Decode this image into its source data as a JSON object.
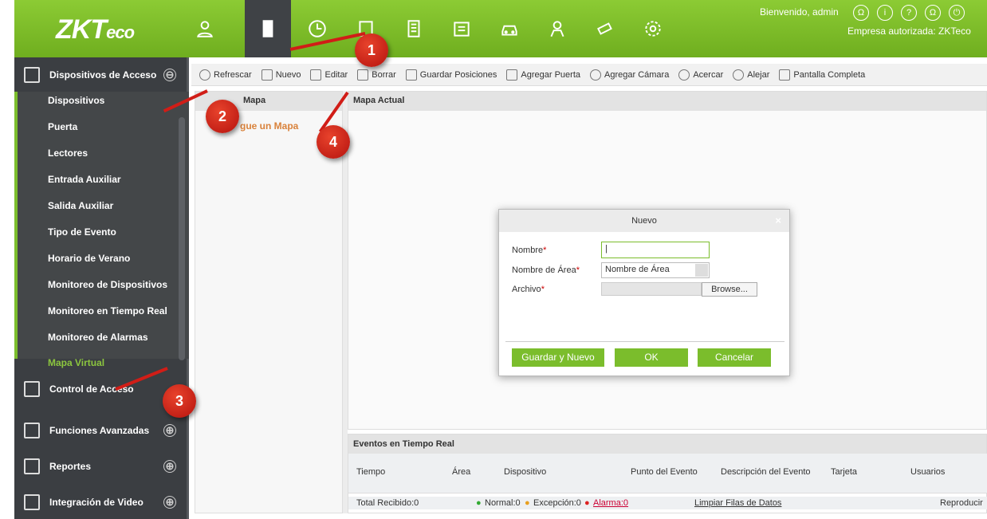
{
  "header": {
    "logo_main": "ZKT",
    "logo_suffix": "eco",
    "welcome": "Bienvenido, admin",
    "company": "Empresa autorizada: ZKTeco",
    "module_icons": [
      "user-icon",
      "door-icon",
      "time-icon",
      "door-grid-icon",
      "building-icon",
      "card-icon",
      "car-icon",
      "visitor-icon",
      "camera-icon",
      "settings-icon"
    ],
    "top_icons": [
      "Ω",
      "i",
      "?",
      "Ω",
      "⏻"
    ]
  },
  "sidebar": {
    "sections": [
      {
        "label": "Dispositivos de Acceso",
        "expand": "⊖"
      },
      {
        "label": "Control de Acceso",
        "expand": ""
      },
      {
        "label": "Funciones Avanzadas",
        "expand": "⊕"
      },
      {
        "label": "Reportes",
        "expand": "⊕"
      },
      {
        "label": "Integración de Video",
        "expand": "⊕"
      }
    ],
    "items": [
      "Dispositivos",
      "Puerta",
      "Lectores",
      "Entrada Auxiliar",
      "Salida Auxiliar",
      "Tipo de Evento",
      "Horario de Verano",
      "Monitoreo de Dispositivos",
      "Monitoreo en Tiempo Real",
      "Monitoreo de Alarmas",
      "Mapa Virtual"
    ],
    "selected": "Mapa Virtual"
  },
  "toolbar": [
    "Refrescar",
    "Nuevo",
    "Editar",
    "Borrar",
    "Guardar Posiciones",
    "Agregar Puerta",
    "Agregar Cámara",
    "Acercar",
    "Alejar",
    "Pantalla Completa"
  ],
  "left_panel": {
    "title": "Mapa",
    "add_link": "gue un Mapa"
  },
  "main_panel": {
    "title": "Mapa Actual"
  },
  "events": {
    "title": "Eventos en Tiempo Real",
    "columns": [
      "Tiempo",
      "Área",
      "Dispositivo",
      "Punto del Evento",
      "Descripción del Evento",
      "Tarjeta",
      "Usuarios"
    ],
    "total": "Total Recibido:0",
    "normal": "Normal:0",
    "exception": "Excepción:0",
    "alarm": "Alarma:0",
    "clear": "Limpiar Filas de Datos",
    "play": "Reproducir"
  },
  "dialog": {
    "title": "Nuevo",
    "close": "×",
    "name_label": "Nombre",
    "area_label": "Nombre de Área",
    "file_label": "Archivo",
    "required": "*",
    "name_value": "|",
    "area_value": "Nombre de Área",
    "browse": "Browse...",
    "btn_save_new": "Guardar y Nuevo",
    "btn_ok": "OK",
    "btn_cancel": "Cancelar"
  },
  "callouts": [
    "1",
    "2",
    "3",
    "4"
  ],
  "colors": {
    "green": "#7bbd2c",
    "sidebar": "#3b3e42",
    "callout": "#d11d17",
    "link_orange": "#d9823b"
  }
}
